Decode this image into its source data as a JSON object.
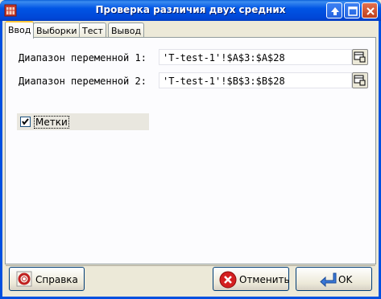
{
  "window": {
    "title": "Проверка различия двух средних"
  },
  "tabs": [
    {
      "label": "Ввод",
      "active": true
    },
    {
      "label": "Выборки",
      "active": false
    },
    {
      "label": "Тест",
      "active": false
    },
    {
      "label": "Вывод",
      "active": false
    }
  ],
  "input_tab": {
    "range1": {
      "label": "Диапазон переменной 1:",
      "value": "'T-test-1'!$A$3:$A$28"
    },
    "range2": {
      "label": "Диапазон переменной 2:",
      "value": "'T-test-1'!$B$3:$B$28"
    },
    "labels_checkbox": {
      "label": "Метки",
      "checked": true
    }
  },
  "buttons": {
    "help": "Справка",
    "cancel": "Отменить",
    "ok": "OK"
  },
  "colors": {
    "titlebar": "#0055e5",
    "active_tab_accent": "#ffc83c",
    "cancel_icon": "#d42020",
    "ok_icon": "#3a78d8"
  },
  "icons": {
    "app": "app-grid-icon",
    "help": "lifebuoy-icon",
    "cancel": "red-x-icon",
    "ok": "enter-arrow-icon",
    "range_picker": "range-select-icon"
  }
}
